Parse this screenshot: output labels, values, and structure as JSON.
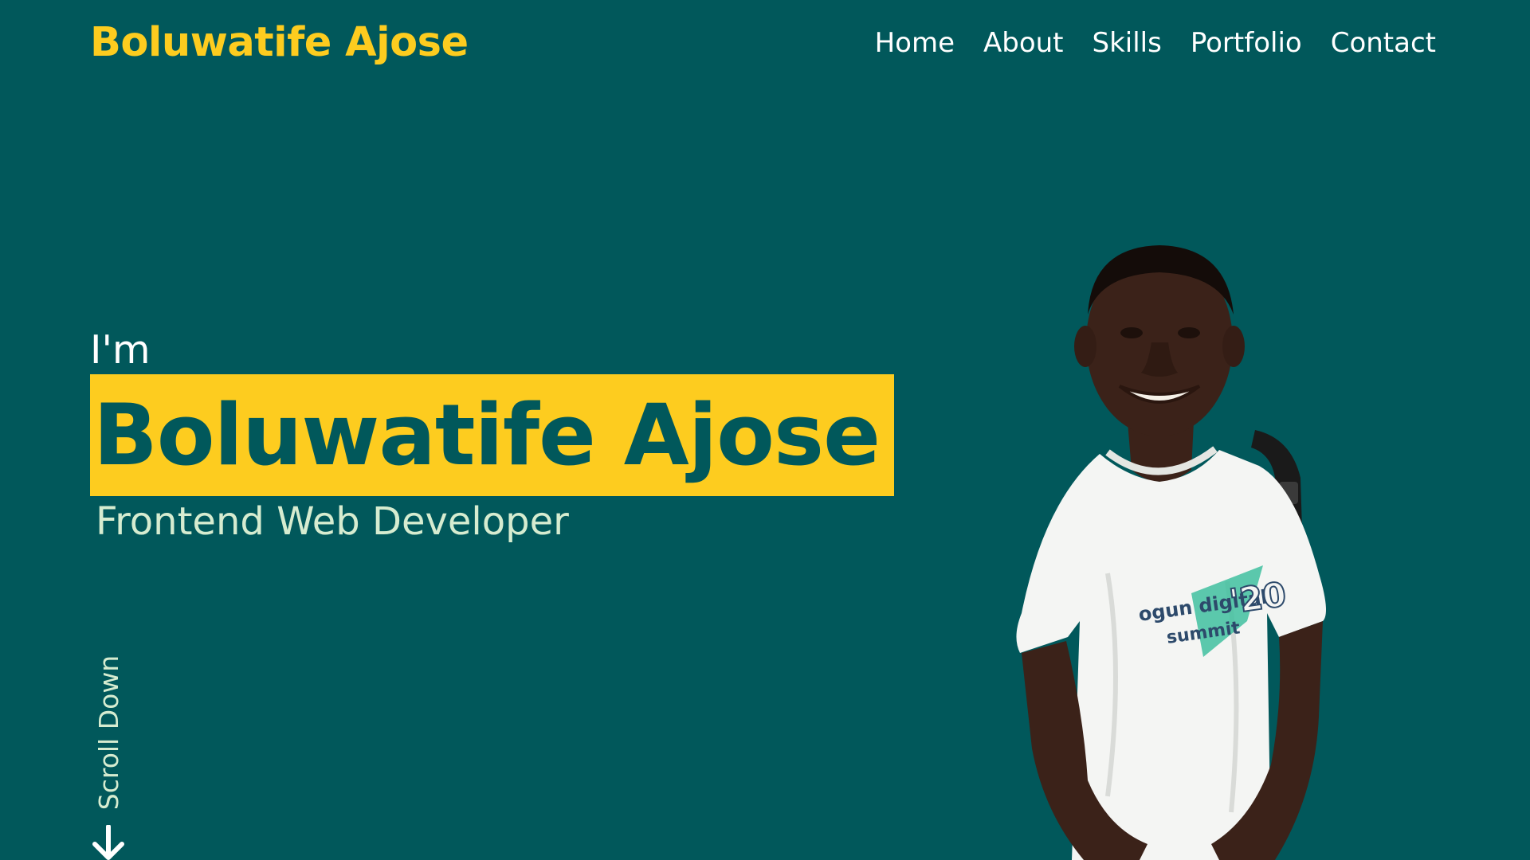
{
  "header": {
    "brand": "Boluwatife Ajose",
    "nav": [
      "Home",
      "About",
      "Skills",
      "Portfolio",
      "Contact"
    ]
  },
  "hero": {
    "intro": "I'm",
    "name": "Boluwatife Ajose",
    "role": "Frontend Web Developer",
    "scroll_label": "Scroll Down",
    "shirt_text_line1": "ogun digital",
    "shirt_text_line2": "summit",
    "shirt_number": "'20"
  },
  "colors": {
    "background": "#01585b",
    "accent": "#fdcc1f",
    "text": "#ffffff",
    "muted": "#d6ecd0"
  },
  "icons": {
    "scroll": "arrow-down-icon",
    "portrait": "person-photo"
  }
}
